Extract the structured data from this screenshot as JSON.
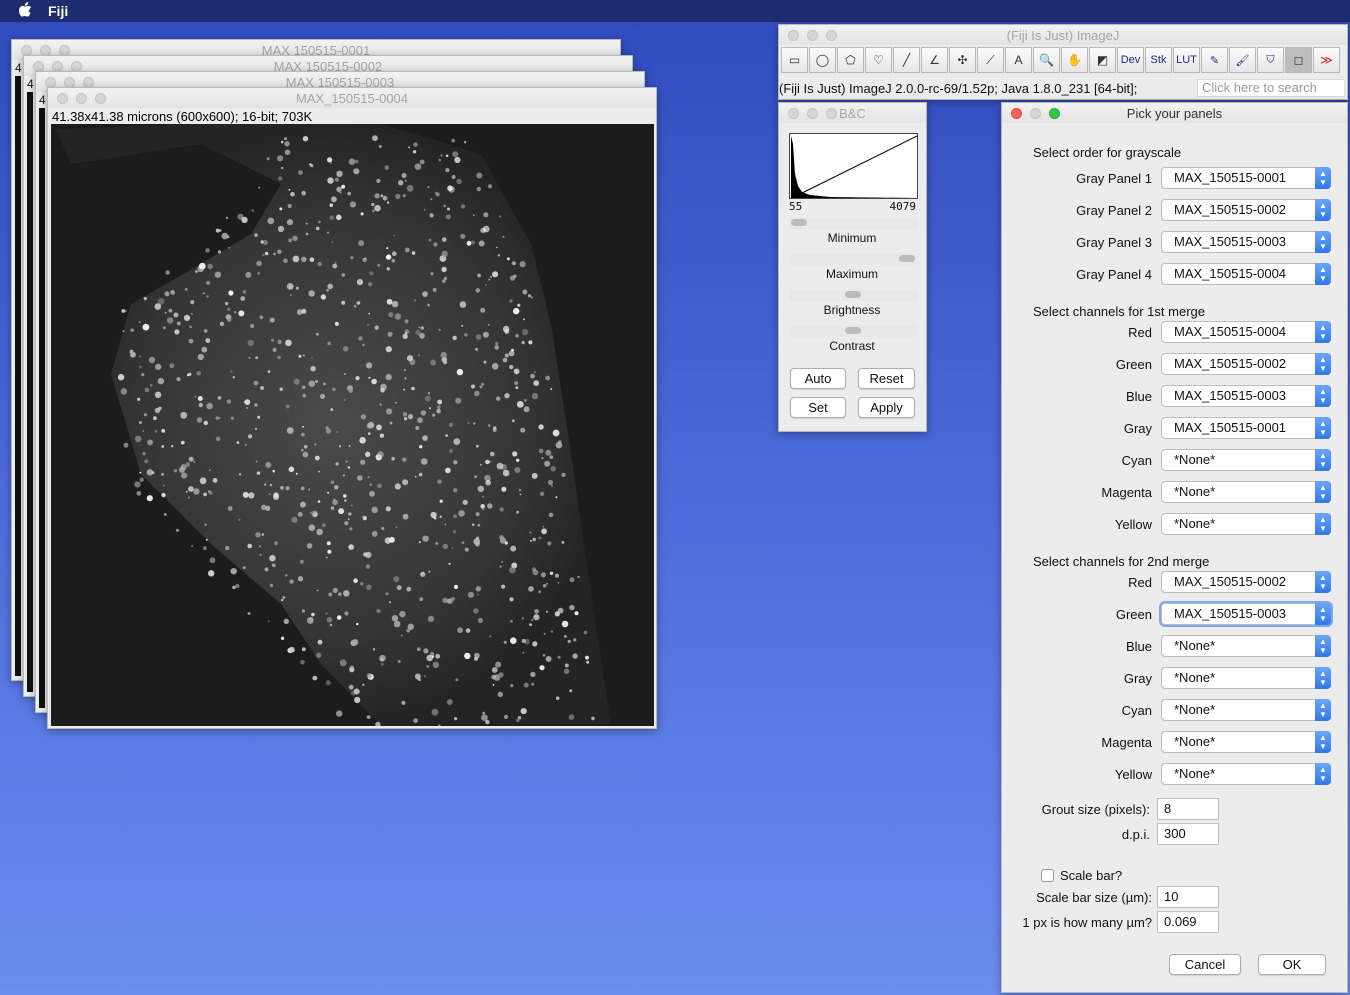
{
  "menubar": {
    "apple": "",
    "app": "Fiji"
  },
  "image_windows": [
    {
      "title": "MAX 150515-0001",
      "edge": "4"
    },
    {
      "title": "MAX 150515-0002",
      "edge": "4"
    },
    {
      "title": "MAX 150515-0003",
      "edge": "4"
    },
    {
      "title": "MAX_150515-0004",
      "info": "41.38x41.38 microns (600x600); 16-bit; 703K"
    }
  ],
  "imagej": {
    "title": "(Fiji Is Just) ImageJ",
    "tools": [
      {
        "name": "rectangle-tool-icon",
        "glyph": "▭"
      },
      {
        "name": "oval-tool-icon",
        "glyph": "◯"
      },
      {
        "name": "polygon-tool-icon",
        "glyph": "⬠"
      },
      {
        "name": "freehand-tool-icon",
        "glyph": "♡"
      },
      {
        "name": "line-tool-icon",
        "glyph": "╱"
      },
      {
        "name": "angle-tool-icon",
        "glyph": "∠"
      },
      {
        "name": "point-tool-icon",
        "glyph": "✣"
      },
      {
        "name": "wand-tool-icon",
        "glyph": "⟋"
      },
      {
        "name": "text-tool-icon",
        "glyph": "A"
      },
      {
        "name": "magnifier-tool-icon",
        "glyph": "🔍"
      },
      {
        "name": "hand-tool-icon",
        "glyph": "✋"
      },
      {
        "name": "color-picker-tool-icon",
        "glyph": "◩"
      },
      {
        "name": "dev-tool-icon",
        "glyph": "Dev"
      },
      {
        "name": "stk-tool-icon",
        "glyph": "Stk"
      },
      {
        "name": "lut-tool-icon",
        "glyph": "LUT"
      },
      {
        "name": "pencil-tool-icon",
        "glyph": "✎"
      },
      {
        "name": "brush-tool-icon",
        "glyph": "🖌"
      },
      {
        "name": "flood-fill-tool-icon",
        "glyph": "⛉"
      },
      {
        "name": "square-tool-icon",
        "glyph": "◻"
      },
      {
        "name": "more-tools-icon",
        "glyph": "≫"
      }
    ],
    "status": "(Fiji Is Just) ImageJ 2.0.0-rc-69/1.52p; Java 1.8.0_231 [64-bit];",
    "search_placeholder": "Click here to search"
  },
  "bc": {
    "title": "B&C",
    "min_value": "55",
    "max_value": "4079",
    "minimum_label": "Minimum",
    "maximum_label": "Maximum",
    "brightness_label": "Brightness",
    "contrast_label": "Contrast",
    "auto": "Auto",
    "reset": "Reset",
    "set": "Set",
    "apply": "Apply"
  },
  "panels": {
    "title": "Pick your panels",
    "grayscale_header": "Select order for grayscale",
    "grayscale": [
      {
        "label": "Gray Panel 1",
        "value": "MAX_150515-0001"
      },
      {
        "label": "Gray Panel 2",
        "value": "MAX_150515-0002"
      },
      {
        "label": "Gray Panel 3",
        "value": "MAX_150515-0003"
      },
      {
        "label": "Gray Panel 4",
        "value": "MAX_150515-0004"
      }
    ],
    "merge1_header": "Select channels for 1st merge",
    "merge1": [
      {
        "label": "Red",
        "value": "MAX_150515-0004"
      },
      {
        "label": "Green",
        "value": "MAX_150515-0002"
      },
      {
        "label": "Blue",
        "value": "MAX_150515-0003"
      },
      {
        "label": "Gray",
        "value": "MAX_150515-0001"
      },
      {
        "label": "Cyan",
        "value": "*None*"
      },
      {
        "label": "Magenta",
        "value": "*None*"
      },
      {
        "label": "Yellow",
        "value": "*None*"
      }
    ],
    "merge2_header": "Select channels for 2nd merge",
    "merge2": [
      {
        "label": "Red",
        "value": "MAX_150515-0002"
      },
      {
        "label": "Green",
        "value": "MAX_150515-0003"
      },
      {
        "label": "Blue",
        "value": "*None*"
      },
      {
        "label": "Gray",
        "value": "*None*"
      },
      {
        "label": "Cyan",
        "value": "*None*"
      },
      {
        "label": "Magenta",
        "value": "*None*"
      },
      {
        "label": "Yellow",
        "value": "*None*"
      }
    ],
    "grout_label": "Grout size (pixels):",
    "grout_value": "8",
    "dpi_label": "d.p.i.",
    "dpi_value": "300",
    "scalebar_label": "Scale bar?",
    "scalebar_size_label": "Scale bar size (µm):",
    "scalebar_size_value": "10",
    "px_label": "1 px is how many µm?",
    "px_value": "0.069",
    "cancel": "Cancel",
    "ok": "OK"
  },
  "colors": {
    "desktop": "#4a67d8",
    "focus_ring": "#7ea8f2",
    "select_arrow": "#2f79ef"
  }
}
